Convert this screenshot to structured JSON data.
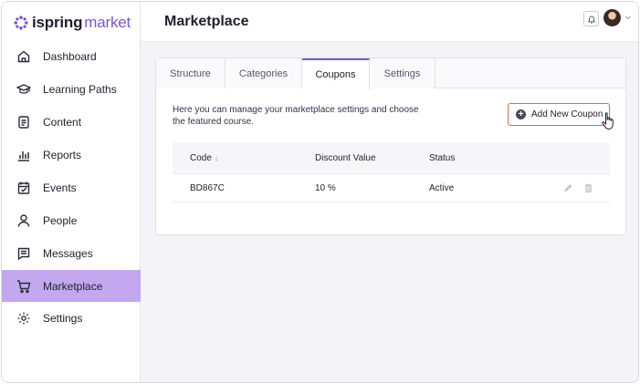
{
  "brand": {
    "name_bold": "ispring",
    "name_light": "market",
    "accent": "#7b55d6"
  },
  "sidebar": {
    "items": [
      {
        "label": "Dashboard",
        "icon": "home-icon"
      },
      {
        "label": "Learning Paths",
        "icon": "graduation-cap-icon"
      },
      {
        "label": "Content",
        "icon": "document-icon"
      },
      {
        "label": "Reports",
        "icon": "bar-chart-icon"
      },
      {
        "label": "Events",
        "icon": "calendar-check-icon"
      },
      {
        "label": "People",
        "icon": "person-icon"
      },
      {
        "label": "Messages",
        "icon": "message-icon"
      },
      {
        "label": "Marketplace",
        "icon": "cart-icon",
        "active": true
      },
      {
        "label": "Settings",
        "icon": "gear-icon"
      }
    ],
    "active_color": "#c3a8f0"
  },
  "header": {
    "title": "Marketplace"
  },
  "tabs": [
    {
      "label": "Structure"
    },
    {
      "label": "Categories"
    },
    {
      "label": "Coupons",
      "active": true
    },
    {
      "label": "Settings"
    }
  ],
  "coupons": {
    "description": "Here you can manage your marketplace settings and choose the featured course.",
    "add_button_label": "Add New Coupon",
    "add_button_border": "#e8634e",
    "columns": [
      "Code",
      "Discount Value",
      "Status"
    ],
    "rows": [
      {
        "code": "BD867C",
        "discount": "10 %",
        "status": "Active"
      }
    ]
  }
}
